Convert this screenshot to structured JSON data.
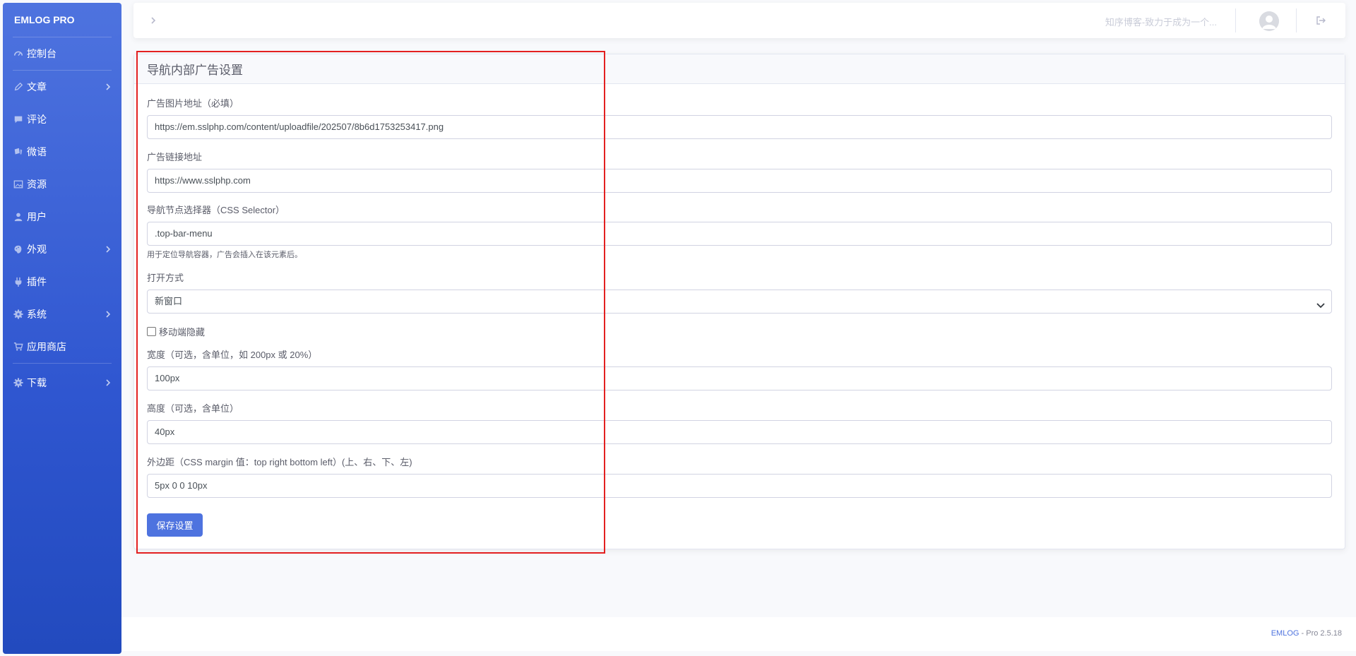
{
  "brand": "EMLOG PRO",
  "sidebar": {
    "items": [
      {
        "label": "控制台",
        "icon": "dashboard-icon",
        "has_children": false
      },
      {
        "label": "文章",
        "icon": "pencil-icon",
        "has_children": true
      },
      {
        "label": "评论",
        "icon": "comment-icon",
        "has_children": false
      },
      {
        "label": "微语",
        "icon": "twitter-icon",
        "has_children": false
      },
      {
        "label": "资源",
        "icon": "image-icon",
        "has_children": false
      },
      {
        "label": "用户",
        "icon": "user-icon",
        "has_children": false
      },
      {
        "label": "外观",
        "icon": "palette-icon",
        "has_children": true
      },
      {
        "label": "插件",
        "icon": "plug-icon",
        "has_children": false
      },
      {
        "label": "系统",
        "icon": "gear-icon",
        "has_children": true
      },
      {
        "label": "应用商店",
        "icon": "cart-icon",
        "has_children": false
      },
      {
        "label": "下载",
        "icon": "gear-icon",
        "has_children": true
      }
    ]
  },
  "topbar": {
    "site_title": "知序博客-致力于成为一个..."
  },
  "card": {
    "title": "导航内部广告设置"
  },
  "form": {
    "image_url": {
      "label": "广告图片地址（必填）",
      "value": "https://em.sslphp.com/content/uploadfile/202507/8b6d1753253417.png"
    },
    "link_url": {
      "label": "广告链接地址",
      "value": "https://www.sslphp.com"
    },
    "selector": {
      "label": "导航节点选择器（CSS Selector）",
      "value": ".top-bar-menu",
      "help": "用于定位导航容器，广告会插入在该元素后。"
    },
    "open_mode": {
      "label": "打开方式",
      "value": "新窗口"
    },
    "mobile_hide": {
      "label": "移动端隐藏",
      "checked": false
    },
    "width": {
      "label": "宽度（可选，含单位，如 200px 或 20%）",
      "value": "100px"
    },
    "height": {
      "label": "高度（可选，含单位）",
      "value": "40px"
    },
    "margin": {
      "label": "外边距（CSS margin 值：top right bottom left）(上、右、下、左)",
      "value": "5px 0 0 10px"
    },
    "save_label": "保存设置"
  },
  "footer": {
    "brand": "EMLOG",
    "version": " - Pro 2.5.18"
  },
  "colors": {
    "accent": "#4e73df",
    "highlight": "#e32020"
  }
}
